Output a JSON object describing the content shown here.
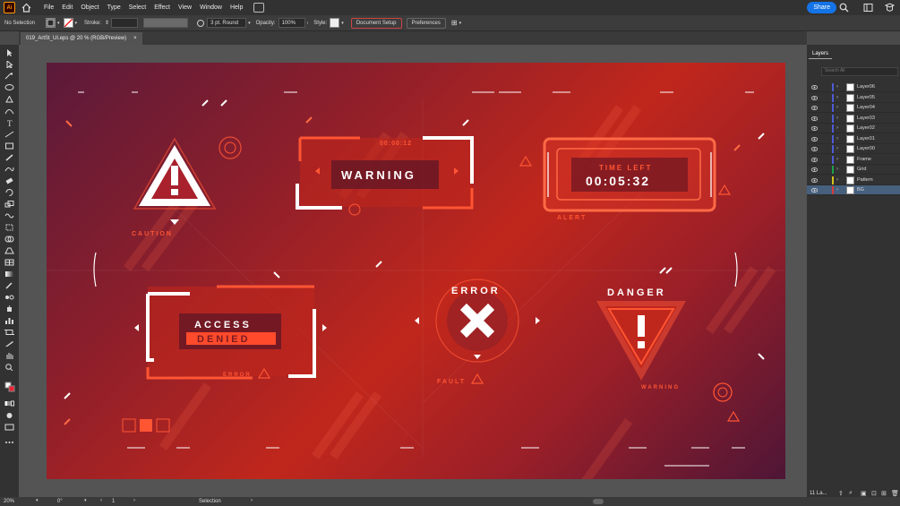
{
  "app": {
    "logo": "Ai",
    "menus": [
      "File",
      "Edit",
      "Object",
      "Type",
      "Select",
      "Effect",
      "View",
      "Window",
      "Help"
    ],
    "share_label": "Share"
  },
  "control_bar": {
    "selection": "No Selection",
    "stroke_label": "Stroke:",
    "brush": "3 pt. Round",
    "opacity_label": "Opacity:",
    "opacity_value": "100%",
    "style_label": "Style:",
    "document_setup": "Document Setup",
    "preferences": "Preferences"
  },
  "document_tab": {
    "title": "019_ArtSt_UI.eps @ 20 % (RGB/Preview)",
    "close": "×"
  },
  "artwork": {
    "warning": "WARNING",
    "time_left": "TIME LEFT",
    "timer": "00:05:32",
    "access": "ACCESS",
    "denied": "DENIED",
    "error": "ERROR",
    "danger": "DANGER",
    "caution": "CAUTION",
    "alert": "ALERT",
    "fault": "FAULT",
    "error_small": "ERROR",
    "warning_small": "WARNING",
    "timer_small": "00:00:12",
    "colors": {
      "accent": "#ff5533",
      "white": "#ffffff",
      "bg_dark": "#5a1a3a",
      "bg_red": "#c0271c"
    }
  },
  "status_bar": {
    "zoom": "20%",
    "rotation": "0°",
    "artboard": "1",
    "tool": "Selection"
  },
  "layers_panel": {
    "title": "Layers",
    "search_placeholder": "Search All",
    "count": "11 La...",
    "items": [
      {
        "name": "Layer06",
        "color": "#4f5bd5"
      },
      {
        "name": "Layer05",
        "color": "#4f5bd5"
      },
      {
        "name": "Layer04",
        "color": "#4f5bd5"
      },
      {
        "name": "Layer03",
        "color": "#4f5bd5"
      },
      {
        "name": "Layer02",
        "color": "#4f5bd5"
      },
      {
        "name": "Layer01",
        "color": "#4f5bd5"
      },
      {
        "name": "Layer00",
        "color": "#4f5bd5"
      },
      {
        "name": "Frame",
        "color": "#4f5bd5"
      },
      {
        "name": "Grid",
        "color": "#1aa34a"
      },
      {
        "name": "Pattern",
        "color": "#d4c21c"
      },
      {
        "name": "BG",
        "color": "#d63c3c"
      }
    ],
    "selected": "BG"
  }
}
